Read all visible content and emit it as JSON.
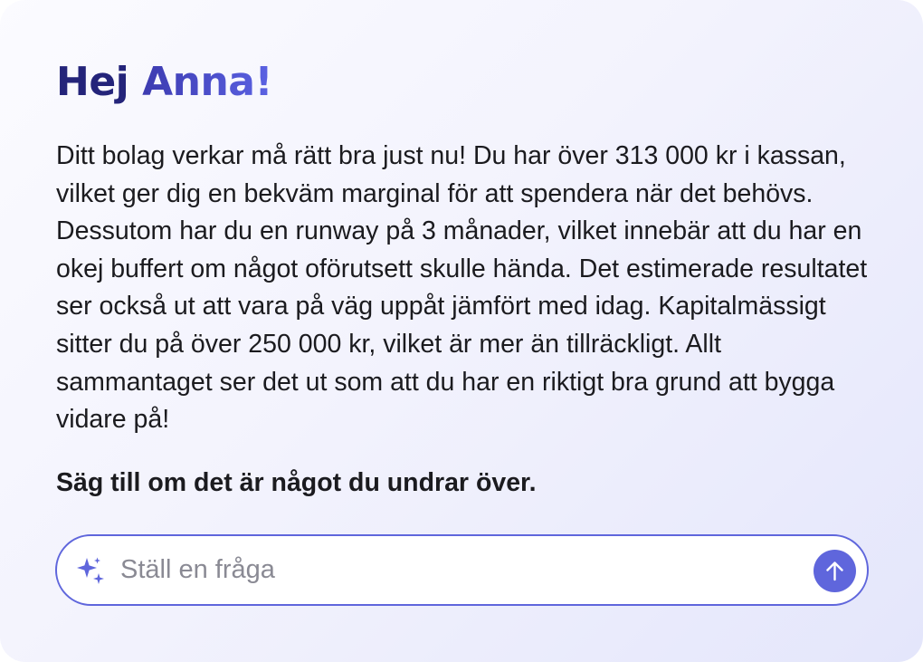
{
  "greeting": {
    "prefix": "Hej ",
    "name": "Anna!"
  },
  "summary": {
    "text": "Ditt bolag verkar må rätt bra just nu! Du har över 313 000 kr i kassan, vilket ger dig en bekväm marginal för att spendera när det behövs. Dessutom har du en runway på 3 månader, vilket innebär att du har en okej buffert om något oförutsett skulle hända. Det estimerade resultatet ser också ut att vara på väg uppåt jämfört med idag. Kapitalmässigt sitter du på över 250 000 kr, vilket är mer än tillräckligt. Allt sammantaget ser det ut som att du har en riktigt bra grund att bygga vidare på!",
    "closing": "Säg till om det är något du undrar över."
  },
  "ask": {
    "placeholder": "Ställ en fråga",
    "value": "",
    "icon": "sparkle-icon",
    "send_icon": "arrow-up-icon",
    "accent_color": "#5f66dc"
  }
}
